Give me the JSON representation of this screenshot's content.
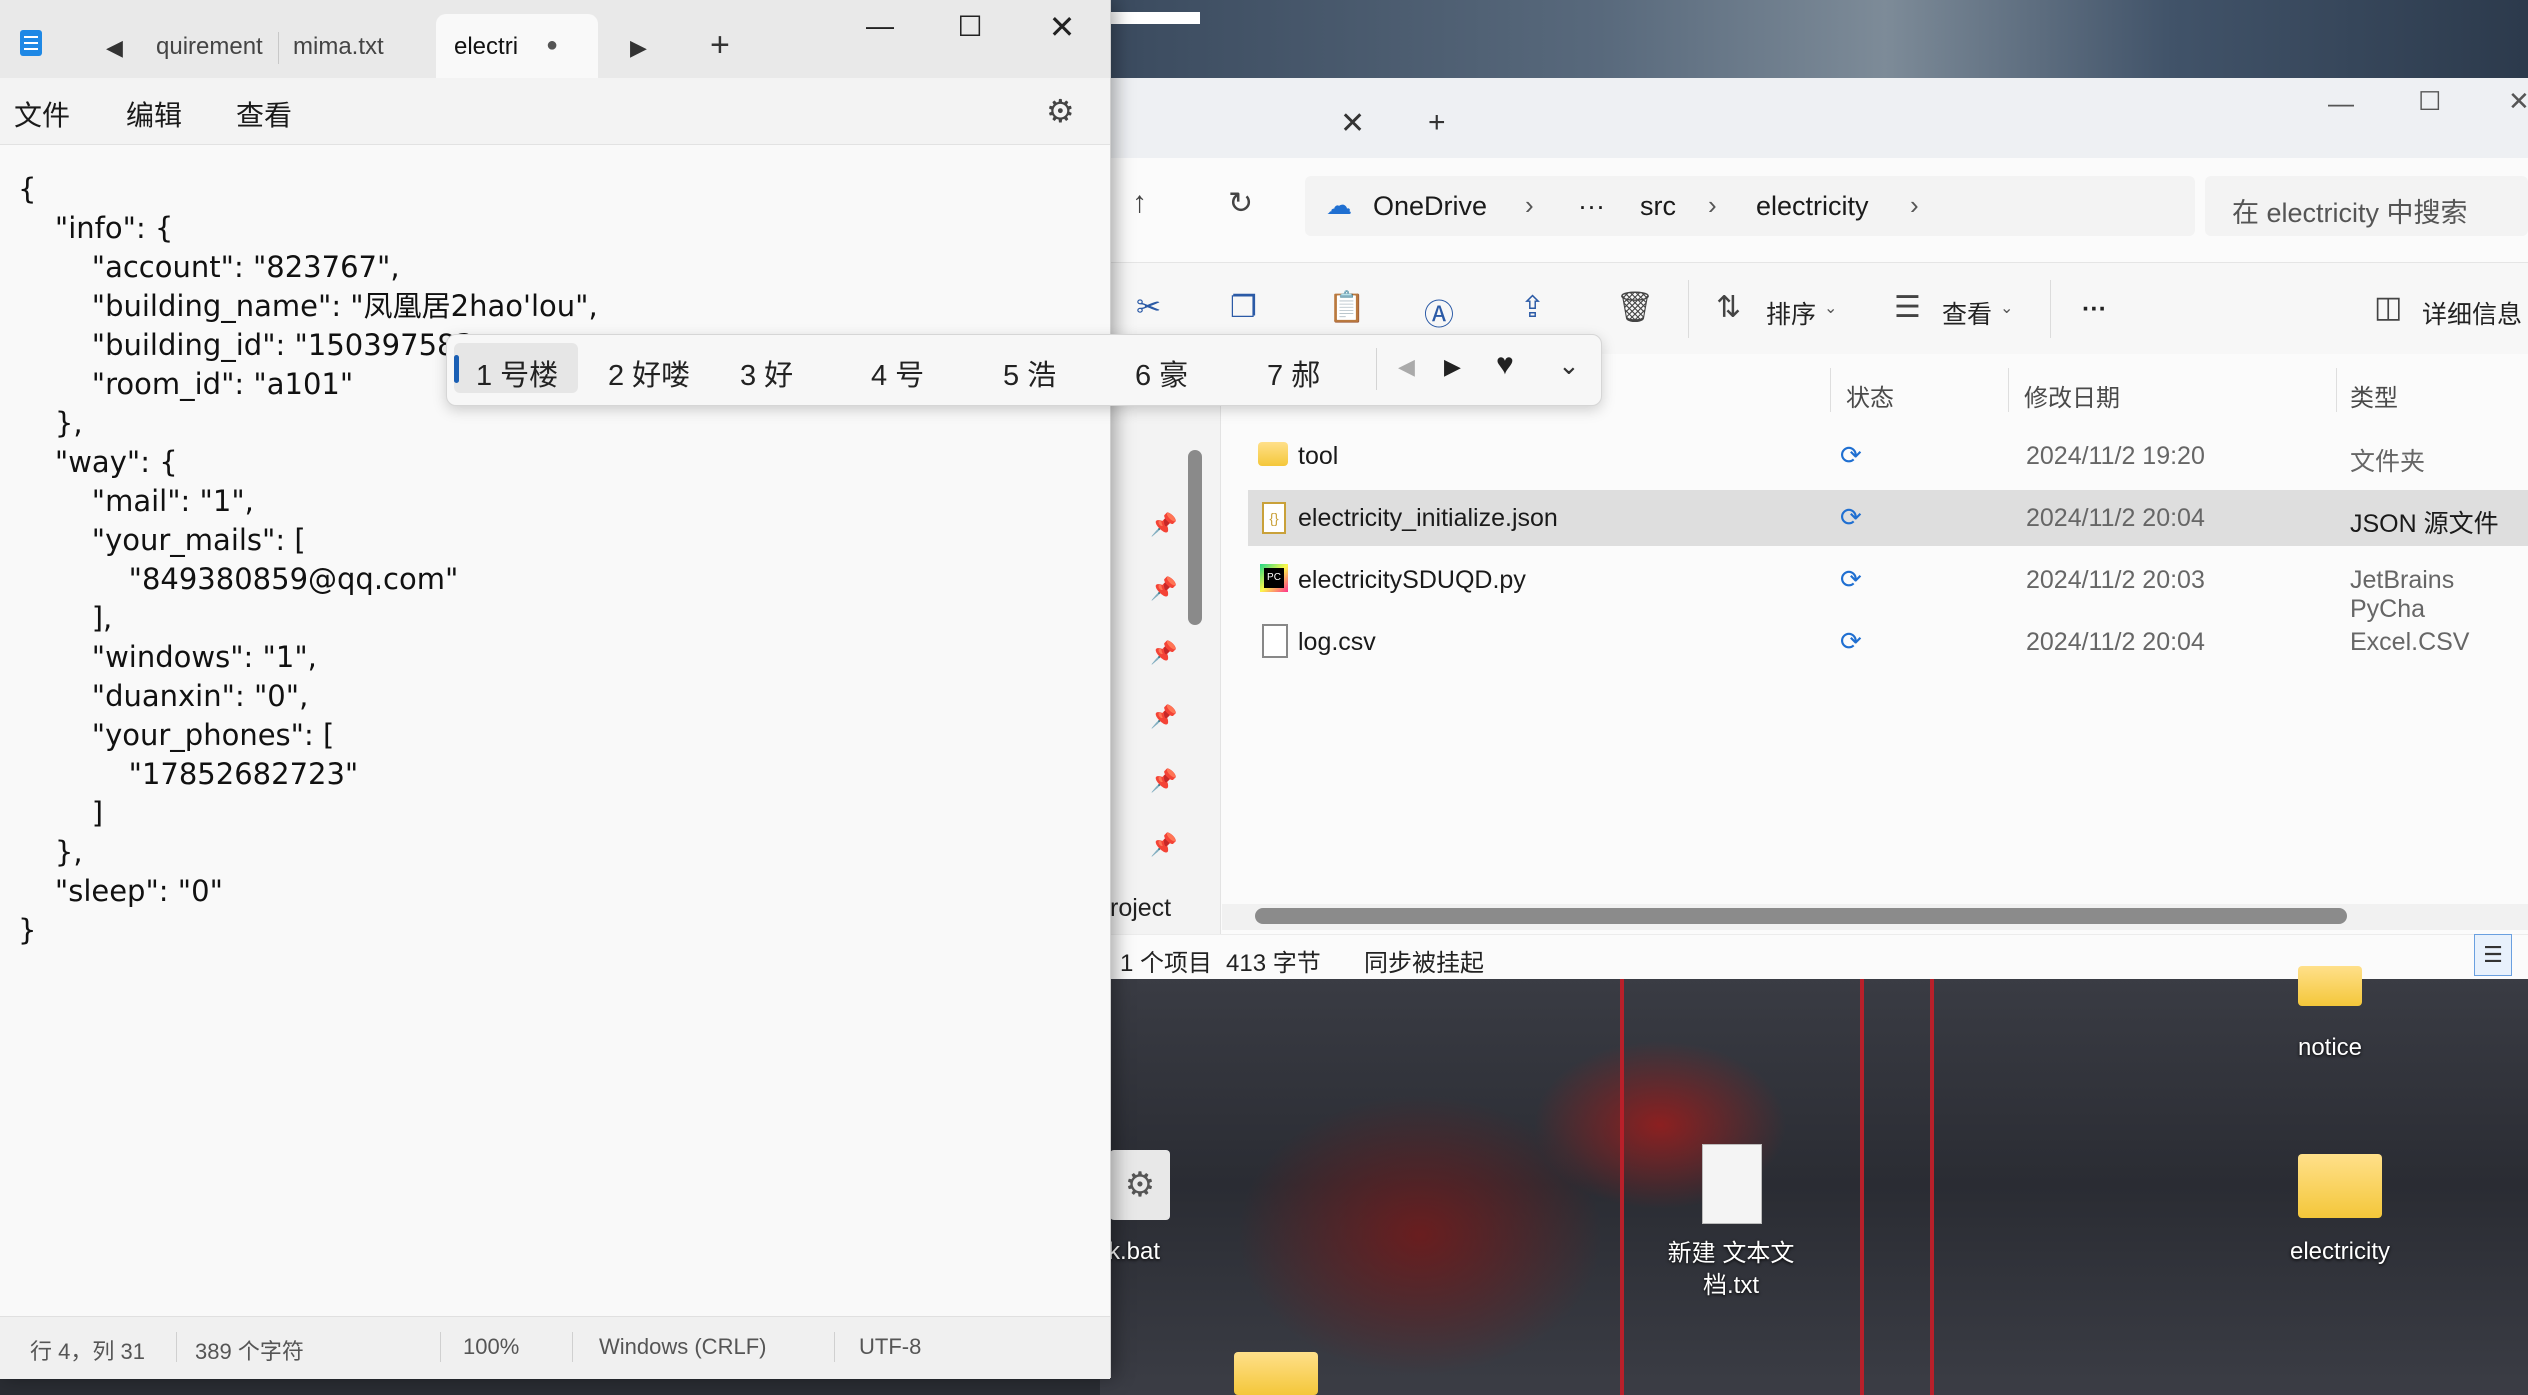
{
  "notepad": {
    "tabs": [
      {
        "label": "quirement"
      },
      {
        "label": "mima.txt"
      },
      {
        "label": "electri",
        "modified_dot": "●"
      }
    ],
    "tab_prev_icon": "◀",
    "tab_next_icon": "▶",
    "new_tab": "+",
    "menu": {
      "file": "文件",
      "edit": "编辑",
      "view": "查看"
    },
    "content_lines": [
      "{",
      "    \"info\": {",
      "        \"account\": \"823767\",",
      "        \"building_name\": \"凤凰居2hao'lou\",",
      "        \"building_id\": \"150397583",
      "        \"room_id\": \"a101\"",
      "    },",
      "    \"way\": {",
      "        \"mail\": \"1\",",
      "        \"your_mails\": [",
      "            \"849380859@qq.com\"",
      "        ],",
      "        \"windows\": \"1\",",
      "        \"duanxin\": \"0\",",
      "        \"your_phones\": [",
      "            \"17852682723\"",
      "        ]",
      "    },",
      "    \"sleep\": \"0\"",
      "}"
    ],
    "status": {
      "position": "行 4，列 31",
      "chars": "389 个字符",
      "zoom": "100%",
      "line_ending": "Windows (CRLF)",
      "encoding": "UTF-8"
    }
  },
  "ime": {
    "candidates": [
      "1 号楼",
      "2 好喽",
      "3 好",
      "4 号",
      "5 浩",
      "6 豪",
      "7 郝"
    ],
    "selected_index": 0
  },
  "explorer": {
    "breadcrumb": [
      "OneDrive",
      "···",
      "src",
      "electricity"
    ],
    "search_placeholder": "在 electricity 中搜索",
    "toolbar": {
      "sort": "排序",
      "view": "查看",
      "more": "···",
      "details": "详细信息"
    },
    "columns": {
      "status": "状态",
      "modified": "修改日期",
      "type": "类型"
    },
    "files": [
      {
        "name": "tool",
        "modified": "2024/11/2 19:20",
        "type": "文件夹",
        "icon": "folder-icon"
      },
      {
        "name": "electricity_initialize.json",
        "modified": "2024/11/2 20:04",
        "type": "JSON 源文件",
        "icon": "json-file-icon",
        "selected": true
      },
      {
        "name": "electricitySDUQD.py",
        "modified": "2024/11/2 20:03",
        "type": "JetBrains PyCha",
        "icon": "pycharm-file-icon"
      },
      {
        "name": "log.csv",
        "modified": "2024/11/2 20:04",
        "type": "Excel.CSV",
        "icon": "csv-file-icon"
      }
    ],
    "nav_partial_label": "roject",
    "status": {
      "selected": "1 个项目",
      "size": "413 字节",
      "sync": "同步被挂起"
    }
  },
  "desktop": {
    "icons": [
      {
        "label": "notice"
      },
      {
        "label": "k.bat"
      },
      {
        "label": "新建 文本文档.txt"
      },
      {
        "label": "electricity"
      }
    ]
  }
}
